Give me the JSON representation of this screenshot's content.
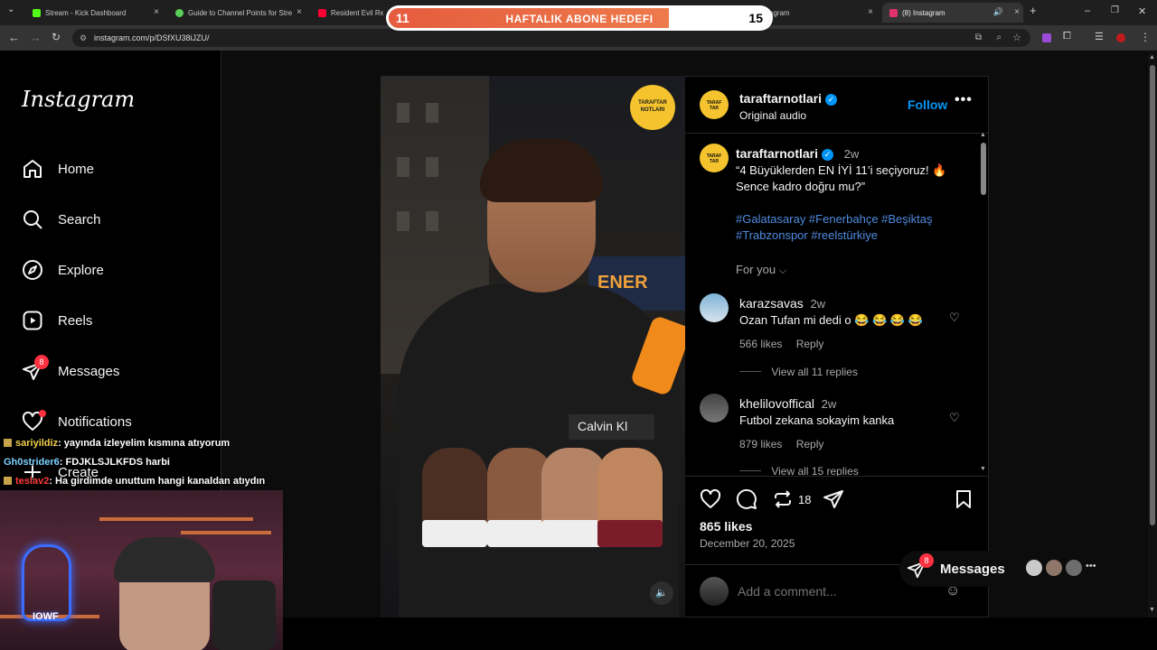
{
  "browser": {
    "tabs": [
      {
        "title": "Stream - Kick Dashboard",
        "color": "#53fc18"
      },
      {
        "title": "Guide to Channel Points for Stre",
        "color": "#5ad05a"
      },
      {
        "title": "Resident Evil Requ",
        "color": "#ff0033"
      },
      {
        "title": "Instagram",
        "color": "#e1306c"
      },
      {
        "title": "(8) Instagram",
        "color": "#e1306c"
      }
    ],
    "url": "instagram.com/p/DSfXU38iJZU/"
  },
  "overlay_banner": {
    "left_count": "11",
    "title": "HAFTALIK ABONE HEDEFI",
    "right_count": "15"
  },
  "sidebar": {
    "logo": "Instagram",
    "items": [
      {
        "label": "Home",
        "icon": "home-icon"
      },
      {
        "label": "Search",
        "icon": "search-icon"
      },
      {
        "label": "Explore",
        "icon": "compass-icon"
      },
      {
        "label": "Reels",
        "icon": "reels-icon"
      },
      {
        "label": "Messages",
        "icon": "messenger-icon",
        "badge": "8"
      },
      {
        "label": "Notifications",
        "icon": "heart-icon"
      },
      {
        "label": "Create",
        "icon": "plus-icon"
      }
    ]
  },
  "video": {
    "logo_line1": "TARAFTAR",
    "logo_line2": "NOTLARI",
    "background_sign": "ENER",
    "shirt_label": "Calvin Kl"
  },
  "post": {
    "author": "taraftarnotlari",
    "audio": "Original audio",
    "follow_label": "Follow",
    "caption_age": "2w",
    "caption": "“4 Büyüklerden EN İYİ 11’i seçiyoruz! 🔥 Sence kadro doğru mu?”",
    "hashtags_line1": "#Galatasaray #Fenerbahçe #Beşiktaş",
    "hashtags_line2": "#Trabzonspor #reelstürkiye",
    "for_you": "For you",
    "comments": [
      {
        "user": "karazsavas",
        "age": "2w",
        "text": "Ozan Tufan mi dedi o 😂 😂 😂 😂",
        "likes": "566 likes",
        "reply": "Reply",
        "view_replies": "View all 11 replies"
      },
      {
        "user": "khelilovoffical",
        "age": "2w",
        "text": "Futbol zekana sokayim kanka",
        "likes": "879 likes",
        "reply": "Reply",
        "view_replies": "View all 15 replies"
      }
    ],
    "repost_count": "18",
    "likes": "865 likes",
    "date": "December 20, 2025",
    "add_comment_placeholder": "Add a comment..."
  },
  "chat": [
    {
      "user": "sariyildiz",
      "text": ": yayında izleyelim kısmına atıyorum"
    },
    {
      "user": "Gh0strider6",
      "text": ": FDJKLSJLKFDS harbi"
    },
    {
      "user": "teslav2",
      "text": ": Ha girdimde unuttum hangi kanaldan atıydın"
    }
  ],
  "webcam": {
    "neon_text": "IOWF"
  },
  "messages_pill": {
    "label": "Messages",
    "badge": "8"
  },
  "colors": {
    "accent": "#0095f6",
    "link": "#4f8bde",
    "badge": "#ff3040",
    "banner": "#e0533a"
  }
}
